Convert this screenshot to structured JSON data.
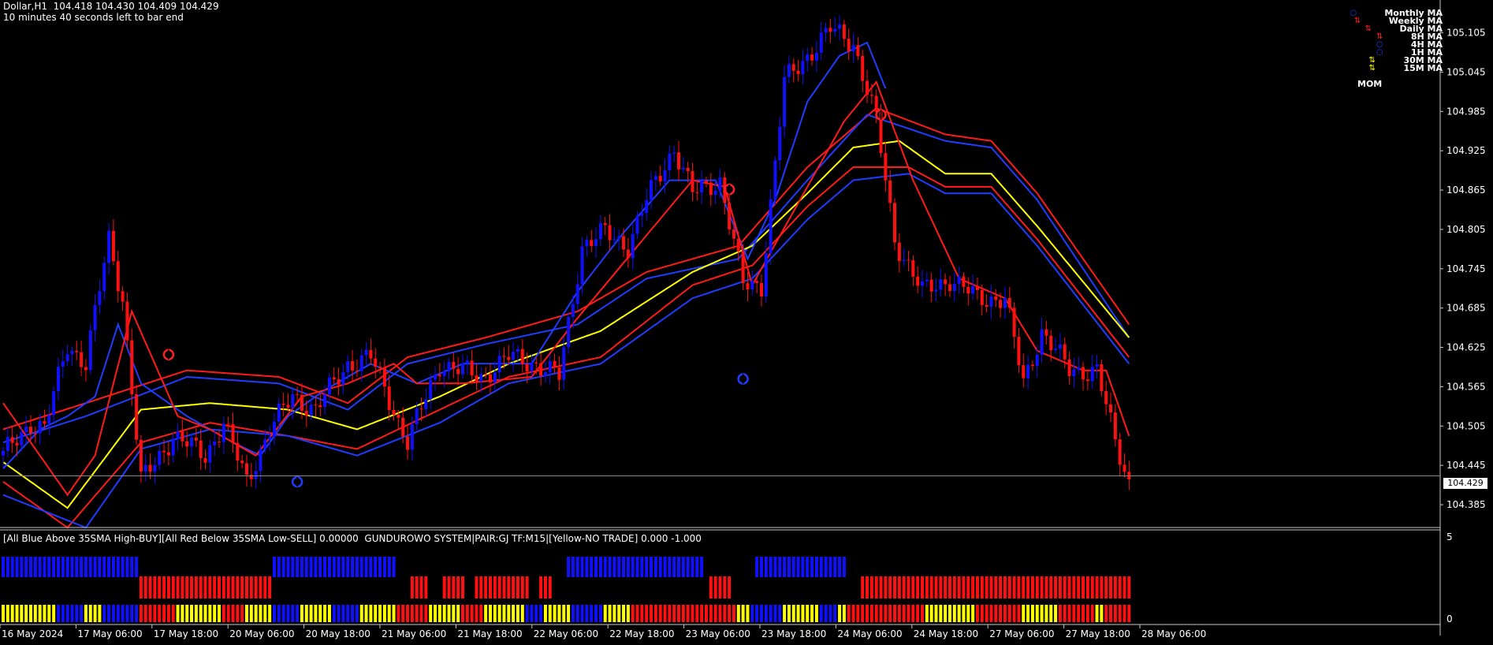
{
  "header": {
    "symbol_line": "Dollar,H1  104.418 104.430 104.409 104.429",
    "timer_line": "10 minutes 40 seconds left to bar end"
  },
  "legend": {
    "items": [
      {
        "label": "Monthly MA",
        "symbol": "circle",
        "color": "#1f3cff"
      },
      {
        "label": "Weekly MA",
        "symbol": "arrows",
        "color": "#ff2020"
      },
      {
        "label": "Daily MA",
        "symbol": "arrows",
        "color": "#ff2020"
      },
      {
        "label": "8H MA",
        "symbol": "arrows",
        "color": "#ff2020"
      },
      {
        "label": "4H MA",
        "symbol": "circle",
        "color": "#1f3cff"
      },
      {
        "label": "1H MA",
        "symbol": "circle",
        "color": "#1f3cff"
      },
      {
        "label": "30M MA",
        "symbol": "arrows",
        "color": "#ffff00"
      },
      {
        "label": "15M MA",
        "symbol": "arrows",
        "color": "#ffff00"
      }
    ],
    "mom_label": "MOM"
  },
  "indicator": {
    "title": "[All Blue Above 35SMA High-BUY][All Red Below 35SMA Low-SELL] 0.00000  GUNDUROWO SYSTEM|PAIR:GJ TF:M15|[Yellow-NO TRADE] 0.000 -1.000",
    "axis_labels": [
      "5",
      "0"
    ]
  },
  "current_price_label": "104.429",
  "colors": {
    "background": "#000000",
    "bull": "#1010ff",
    "bear": "#ff1010",
    "neutral": "#ffff00",
    "ma_blue": "#1f3cff",
    "ma_red": "#ff1a1a",
    "ma_yellow": "#ffff00",
    "grid_axis": "#c8c8c8"
  },
  "chart_data": {
    "type": "candlestick",
    "y_ticks": [
      "105.105",
      "105.045",
      "104.985",
      "104.925",
      "104.865",
      "104.805",
      "104.745",
      "104.685",
      "104.625",
      "104.565",
      "104.505",
      "104.445",
      "104.385"
    ],
    "ylim": [
      104.355,
      105.155
    ],
    "x_ticks": [
      "16 May 2024",
      "17 May 06:00",
      "17 May 18:00",
      "20 May 06:00",
      "20 May 18:00",
      "21 May 06:00",
      "21 May 18:00",
      "22 May 06:00",
      "22 May 18:00",
      "23 May 06:00",
      "23 May 18:00",
      "24 May 06:00",
      "24 May 18:00",
      "27 May 06:00",
      "27 May 18:00",
      "28 May 06:00"
    ],
    "current_price": 104.429,
    "anchors": [
      {
        "b": 0,
        "p": 104.46
      },
      {
        "b": 6,
        "p": 104.51
      },
      {
        "b": 9,
        "p": 104.5
      },
      {
        "b": 14,
        "p": 104.63
      },
      {
        "b": 18,
        "p": 104.6
      },
      {
        "b": 23,
        "p": 104.79
      },
      {
        "b": 26,
        "p": 104.7
      },
      {
        "b": 30,
        "p": 104.42
      },
      {
        "b": 37,
        "p": 104.49
      },
      {
        "b": 44,
        "p": 104.46
      },
      {
        "b": 48,
        "p": 104.51
      },
      {
        "b": 53,
        "p": 104.42
      },
      {
        "b": 58,
        "p": 104.5
      },
      {
        "b": 63,
        "p": 104.55
      },
      {
        "b": 68,
        "p": 104.53
      },
      {
        "b": 75,
        "p": 104.6
      },
      {
        "b": 80,
        "p": 104.61
      },
      {
        "b": 85,
        "p": 104.53
      },
      {
        "b": 88,
        "p": 104.48
      },
      {
        "b": 95,
        "p": 104.6
      },
      {
        "b": 104,
        "p": 104.58
      },
      {
        "b": 110,
        "p": 104.61
      },
      {
        "b": 116,
        "p": 104.6
      },
      {
        "b": 121,
        "p": 104.58
      },
      {
        "b": 126,
        "p": 104.78
      },
      {
        "b": 131,
        "p": 104.8
      },
      {
        "b": 136,
        "p": 104.78
      },
      {
        "b": 140,
        "p": 104.85
      },
      {
        "b": 146,
        "p": 104.93
      },
      {
        "b": 150,
        "p": 104.86
      },
      {
        "b": 156,
        "p": 104.88
      },
      {
        "b": 161,
        "p": 104.72
      },
      {
        "b": 165,
        "p": 104.72
      },
      {
        "b": 170,
        "p": 105.03
      },
      {
        "b": 175,
        "p": 105.07
      },
      {
        "b": 180,
        "p": 105.11
      },
      {
        "b": 185,
        "p": 105.09
      },
      {
        "b": 190,
        "p": 104.97
      },
      {
        "b": 194,
        "p": 104.79
      },
      {
        "b": 200,
        "p": 104.71
      },
      {
        "b": 206,
        "p": 104.73
      },
      {
        "b": 212,
        "p": 104.7
      },
      {
        "b": 218,
        "p": 104.7
      },
      {
        "b": 222,
        "p": 104.57
      },
      {
        "b": 226,
        "p": 104.65
      },
      {
        "b": 232,
        "p": 104.59
      },
      {
        "b": 238,
        "p": 104.59
      },
      {
        "b": 242,
        "p": 104.48
      },
      {
        "b": 245,
        "p": 104.42
      }
    ],
    "moving_averages": [
      {
        "name": "upper-red",
        "color": "#ff1a1a",
        "points": [
          [
            0,
            104.5
          ],
          [
            18,
            104.54
          ],
          [
            40,
            104.59
          ],
          [
            60,
            104.58
          ],
          [
            75,
            104.54
          ],
          [
            88,
            104.61
          ],
          [
            105,
            104.64
          ],
          [
            125,
            104.68
          ],
          [
            140,
            104.74
          ],
          [
            160,
            104.78
          ],
          [
            175,
            104.9
          ],
          [
            190,
            104.99
          ],
          [
            205,
            104.95
          ],
          [
            215,
            104.94
          ],
          [
            225,
            104.86
          ],
          [
            245,
            104.66
          ]
        ]
      },
      {
        "name": "upper-blue",
        "color": "#1f3cff",
        "points": [
          [
            0,
            104.48
          ],
          [
            18,
            104.52
          ],
          [
            40,
            104.58
          ],
          [
            60,
            104.57
          ],
          [
            75,
            104.53
          ],
          [
            88,
            104.6
          ],
          [
            105,
            104.63
          ],
          [
            125,
            104.66
          ],
          [
            140,
            104.73
          ],
          [
            160,
            104.76
          ],
          [
            175,
            104.88
          ],
          [
            188,
            104.98
          ],
          [
            205,
            104.94
          ],
          [
            215,
            104.93
          ],
          [
            225,
            104.85
          ],
          [
            245,
            104.64
          ]
        ]
      },
      {
        "name": "center-yellow",
        "color": "#ffff00",
        "points": [
          [
            0,
            104.45
          ],
          [
            14,
            104.38
          ],
          [
            30,
            104.53
          ],
          [
            45,
            104.54
          ],
          [
            62,
            104.53
          ],
          [
            77,
            104.5
          ],
          [
            95,
            104.55
          ],
          [
            110,
            104.6
          ],
          [
            130,
            104.65
          ],
          [
            150,
            104.74
          ],
          [
            163,
            104.78
          ],
          [
            175,
            104.86
          ],
          [
            185,
            104.93
          ],
          [
            195,
            104.94
          ],
          [
            205,
            104.89
          ],
          [
            215,
            104.89
          ],
          [
            225,
            104.81
          ],
          [
            245,
            104.64
          ]
        ]
      },
      {
        "name": "lower-red",
        "color": "#ff1a1a",
        "points": [
          [
            0,
            104.42
          ],
          [
            14,
            104.35
          ],
          [
            30,
            104.48
          ],
          [
            45,
            104.51
          ],
          [
            62,
            104.49
          ],
          [
            77,
            104.47
          ],
          [
            95,
            104.53
          ],
          [
            110,
            104.58
          ],
          [
            130,
            104.61
          ],
          [
            150,
            104.72
          ],
          [
            163,
            104.75
          ],
          [
            175,
            104.84
          ],
          [
            185,
            104.9
          ],
          [
            197,
            104.9
          ],
          [
            205,
            104.87
          ],
          [
            215,
            104.87
          ],
          [
            225,
            104.79
          ],
          [
            245,
            104.61
          ]
        ]
      },
      {
        "name": "lower-blue",
        "color": "#1f3cff",
        "points": [
          [
            0,
            104.4
          ],
          [
            18,
            104.35
          ],
          [
            30,
            104.47
          ],
          [
            45,
            104.5
          ],
          [
            62,
            104.49
          ],
          [
            77,
            104.46
          ],
          [
            95,
            104.51
          ],
          [
            110,
            104.57
          ],
          [
            130,
            104.6
          ],
          [
            150,
            104.7
          ],
          [
            163,
            104.73
          ],
          [
            175,
            104.82
          ],
          [
            185,
            104.88
          ],
          [
            197,
            104.89
          ],
          [
            205,
            104.86
          ],
          [
            215,
            104.86
          ],
          [
            225,
            104.78
          ],
          [
            245,
            104.6
          ]
        ]
      },
      {
        "name": "fast-blue",
        "color": "#1f3cff",
        "points": [
          [
            0,
            104.44
          ],
          [
            8,
            104.5
          ],
          [
            14,
            104.52
          ],
          [
            20,
            104.55
          ],
          [
            25,
            104.66
          ],
          [
            30,
            104.57
          ],
          [
            40,
            104.52
          ],
          [
            50,
            104.48
          ],
          [
            56,
            104.46
          ],
          [
            62,
            104.52
          ],
          [
            70,
            104.56
          ],
          [
            80,
            104.6
          ],
          [
            90,
            104.57
          ],
          [
            100,
            104.6
          ],
          [
            115,
            104.6
          ],
          [
            125,
            104.71
          ],
          [
            135,
            104.8
          ],
          [
            145,
            104.88
          ],
          [
            155,
            104.88
          ],
          [
            162,
            104.76
          ],
          [
            168,
            104.85
          ],
          [
            175,
            105.0
          ],
          [
            182,
            105.07
          ],
          [
            188,
            105.09
          ],
          [
            192,
            105.02
          ]
        ]
      },
      {
        "name": "fast-red",
        "color": "#ff1a1a",
        "points": [
          [
            0,
            104.54
          ],
          [
            10,
            104.44
          ],
          [
            14,
            104.4
          ],
          [
            20,
            104.46
          ],
          [
            28,
            104.68
          ],
          [
            33,
            104.6
          ],
          [
            38,
            104.52
          ],
          [
            45,
            104.5
          ],
          [
            55,
            104.46
          ],
          [
            65,
            104.55
          ],
          [
            75,
            104.57
          ],
          [
            85,
            104.6
          ],
          [
            90,
            104.57
          ],
          [
            100,
            104.57
          ],
          [
            115,
            104.58
          ],
          [
            125,
            104.67
          ],
          [
            150,
            104.88
          ],
          [
            157,
            104.87
          ],
          [
            163,
            104.72
          ],
          [
            183,
            104.97
          ],
          [
            190,
            105.03
          ],
          [
            198,
            104.88
          ],
          [
            208,
            104.73
          ],
          [
            218,
            104.7
          ],
          [
            225,
            104.62
          ],
          [
            235,
            104.59
          ],
          [
            240,
            104.59
          ],
          [
            245,
            104.49
          ]
        ]
      }
    ],
    "markers": [
      {
        "b": 36,
        "p": 104.614,
        "color": "#ff2020"
      },
      {
        "b": 64,
        "p": 104.42,
        "color": "#1f3cff"
      },
      {
        "b": 158,
        "p": 104.866,
        "color": "#ff2020"
      },
      {
        "b": 161,
        "p": 104.577,
        "color": "#1f3cff"
      },
      {
        "b": 191,
        "p": 104.98,
        "color": "#ff2020"
      }
    ],
    "histogram_rows": [
      {
        "row": "top",
        "segments": [
          {
            "from": 0,
            "to": 30,
            "state": "bull"
          },
          {
            "from": 59,
            "to": 86,
            "state": "bull"
          },
          {
            "from": 123,
            "to": 153,
            "state": "bull"
          },
          {
            "from": 164,
            "to": 184,
            "state": "bull"
          }
        ]
      },
      {
        "row": "middle",
        "segments": [
          {
            "from": 30,
            "to": 59,
            "state": "bear"
          },
          {
            "from": 89,
            "to": 93,
            "state": "bear"
          },
          {
            "from": 96,
            "to": 101,
            "state": "bear"
          },
          {
            "from": 103,
            "to": 115,
            "state": "bear"
          },
          {
            "from": 117,
            "to": 120,
            "state": "bear"
          },
          {
            "from": 154,
            "to": 159,
            "state": "bear"
          },
          {
            "from": 187,
            "to": 246,
            "state": "bear"
          }
        ]
      },
      {
        "row": "bottom",
        "segments": [
          {
            "from": 0,
            "to": 12,
            "state": "neutral"
          },
          {
            "from": 12,
            "to": 18,
            "state": "bull"
          },
          {
            "from": 18,
            "to": 22,
            "state": "neutral"
          },
          {
            "from": 22,
            "to": 30,
            "state": "bull"
          },
          {
            "from": 30,
            "to": 38,
            "state": "bear"
          },
          {
            "from": 38,
            "to": 48,
            "state": "neutral"
          },
          {
            "from": 48,
            "to": 53,
            "state": "bear"
          },
          {
            "from": 53,
            "to": 59,
            "state": "neutral"
          },
          {
            "from": 59,
            "to": 65,
            "state": "bull"
          },
          {
            "from": 65,
            "to": 72,
            "state": "neutral"
          },
          {
            "from": 72,
            "to": 78,
            "state": "bull"
          },
          {
            "from": 78,
            "to": 86,
            "state": "neutral"
          },
          {
            "from": 86,
            "to": 93,
            "state": "bear"
          },
          {
            "from": 93,
            "to": 100,
            "state": "neutral"
          },
          {
            "from": 100,
            "to": 105,
            "state": "bear"
          },
          {
            "from": 105,
            "to": 114,
            "state": "neutral"
          },
          {
            "from": 114,
            "to": 118,
            "state": "bull"
          },
          {
            "from": 118,
            "to": 124,
            "state": "neutral"
          },
          {
            "from": 124,
            "to": 131,
            "state": "bull"
          },
          {
            "from": 131,
            "to": 137,
            "state": "neutral"
          },
          {
            "from": 137,
            "to": 153,
            "state": "bear"
          },
          {
            "from": 153,
            "to": 160,
            "state": "bear"
          },
          {
            "from": 160,
            "to": 163,
            "state": "neutral"
          },
          {
            "from": 163,
            "to": 170,
            "state": "bull"
          },
          {
            "from": 170,
            "to": 178,
            "state": "neutral"
          },
          {
            "from": 178,
            "to": 182,
            "state": "bull"
          },
          {
            "from": 182,
            "to": 184,
            "state": "neutral"
          },
          {
            "from": 184,
            "to": 201,
            "state": "bear"
          },
          {
            "from": 201,
            "to": 212,
            "state": "neutral"
          },
          {
            "from": 212,
            "to": 222,
            "state": "bear"
          },
          {
            "from": 222,
            "to": 230,
            "state": "neutral"
          },
          {
            "from": 230,
            "to": 238,
            "state": "bear"
          },
          {
            "from": 238,
            "to": 240,
            "state": "neutral"
          },
          {
            "from": 240,
            "to": 246,
            "state": "bear"
          }
        ]
      }
    ]
  }
}
